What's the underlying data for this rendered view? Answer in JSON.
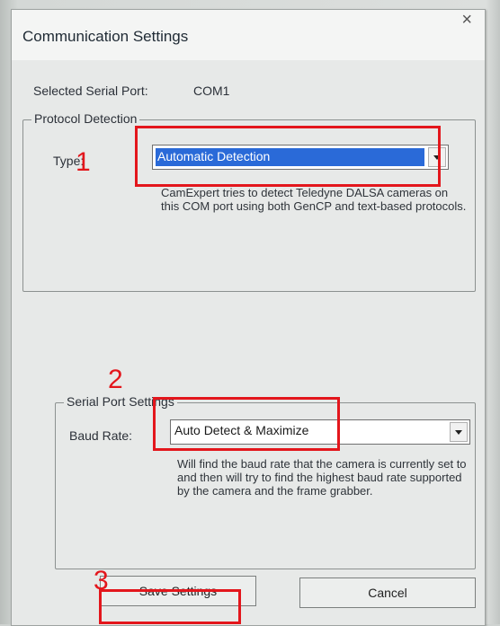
{
  "dialog": {
    "title": "Communication Settings",
    "close_glyph": "×"
  },
  "serial_port": {
    "label": "Selected Serial Port:",
    "value": "COM1"
  },
  "protocol": {
    "group_label": "Protocol Detection",
    "type_label": "Type:",
    "type_value": "Automatic Detection",
    "description": "CamExpert tries to detect Teledyne DALSA cameras on this COM port using both GenCP and text-based protocols."
  },
  "serial_settings": {
    "group_label": "Serial Port Settings",
    "baud_label": "Baud Rate:",
    "baud_value": "Auto Detect & Maximize",
    "description": "Will find the baud rate that the camera is currently set to and then will try to find the highest baud rate supported by the camera and the frame grabber."
  },
  "buttons": {
    "save": "Save Settings",
    "cancel": "Cancel"
  },
  "annotations": {
    "n1": "1",
    "n2": "2",
    "n3": "3",
    "color": "#e3161c"
  }
}
